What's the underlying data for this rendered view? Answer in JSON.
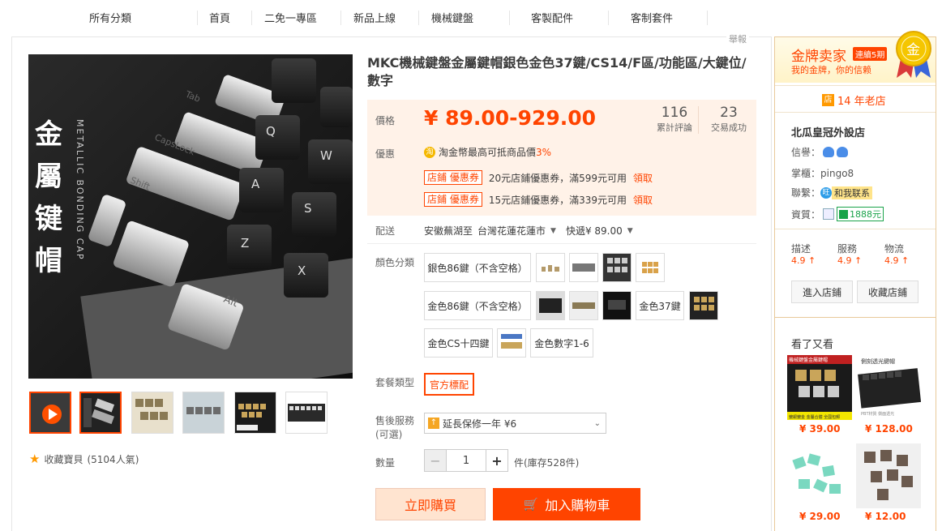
{
  "nav": {
    "items": [
      "所有分類",
      "首頁",
      "二免一專區",
      "新品上線",
      "機械鍵盤",
      "客製配件",
      "客制套件"
    ]
  },
  "report_label": "舉報",
  "gallery": {
    "vertical_text": [
      "金",
      "屬",
      "键",
      "帽"
    ],
    "metallic_text": "METALLIC BONDING CAP",
    "keys": [
      "Tab",
      "CapsLock",
      "Shift",
      "Alt",
      "Q",
      "W",
      "A",
      "S",
      "Z",
      "X"
    ],
    "favorite_label": "收藏寶貝",
    "favorite_count": "(5104人氣)"
  },
  "product": {
    "title": "MKC機械鍵盤金屬鍵帽銀色金色37鍵/CS14/F區/功能區/大鍵位/數字",
    "price_label": "價格",
    "price": "¥ 89.00-929.00",
    "reviews_count": "116",
    "reviews_label": "累計評論",
    "sales_count": "23",
    "sales_label": "交易成功",
    "promo_label": "優惠",
    "coin_text": "淘金幣最高可抵商品價",
    "coin_pct": "3%",
    "coupons": [
      {
        "tag": "店鋪 優惠券",
        "text": "20元店鋪優惠券，滿599元可用",
        "claim": "領取"
      },
      {
        "tag": "店鋪 優惠券",
        "text": "15元店鋪優惠券，滿339元可用",
        "claim": "領取"
      }
    ],
    "shipping_label": "配送",
    "shipping_from": "安徽蕪湖至",
    "shipping_to": "台灣花蓮花蓮市",
    "shipping_fee": "快遞¥ 89.00",
    "color_label": "顏色分類",
    "color_options": [
      "銀色86鍵（不含空格）",
      "金色86鍵（不含空格）",
      "金色37鍵",
      "金色CS十四鍵",
      "金色數字1-6"
    ],
    "package_label": "套餐類型",
    "package_value": "官方標配",
    "service_label": "售後服務",
    "service_sub": "(可選)",
    "service_value": "延長保修一年 ¥6",
    "qty_label": "數量",
    "qty_value": "1",
    "qty_minus": "−",
    "qty_plus": "+",
    "stock_text": "件(庫存528件)",
    "buy_now": "立即購買",
    "add_cart": "加入購物車"
  },
  "seller": {
    "gold_title": "金牌卖家",
    "gold_badge": "連續5期",
    "gold_sub": "我的金牌，你的信赖",
    "medal_char": "金",
    "years": "14 年老店",
    "shop_name": "北瓜皇冠外設店",
    "credit_label": "信譽：",
    "keeper_label": "掌櫃：",
    "keeper_name": "pingo8",
    "contact_label": "聯繫：",
    "contact_btn": "和我联系",
    "qual_label": "資質：",
    "qual_value": "1888元",
    "ratings": [
      {
        "name": "描述",
        "score": "4.9"
      },
      {
        "name": "服務",
        "score": "4.9"
      },
      {
        "name": "物流",
        "score": "4.9"
      }
    ],
    "enter_shop": "進入店鋪",
    "fav_shop": "收藏店鋪"
  },
  "also_viewed": {
    "title": "看了又看",
    "items": [
      {
        "price": "¥ 39.00",
        "caption": "機械鍵盤金屬鍵帽",
        "sub": "鍍銀鍍金 金屬合體 全國包郵"
      },
      {
        "price": "¥ 128.00",
        "caption": "側刻透光鍵帽",
        "sub": "PBT材質 側面透光"
      },
      {
        "price": "¥ 29.00"
      },
      {
        "price": "¥ 12.00"
      }
    ]
  },
  "colors": {
    "accent": "#ff4400",
    "price_bg": "#fff2e8",
    "gold": "#f5b800"
  }
}
